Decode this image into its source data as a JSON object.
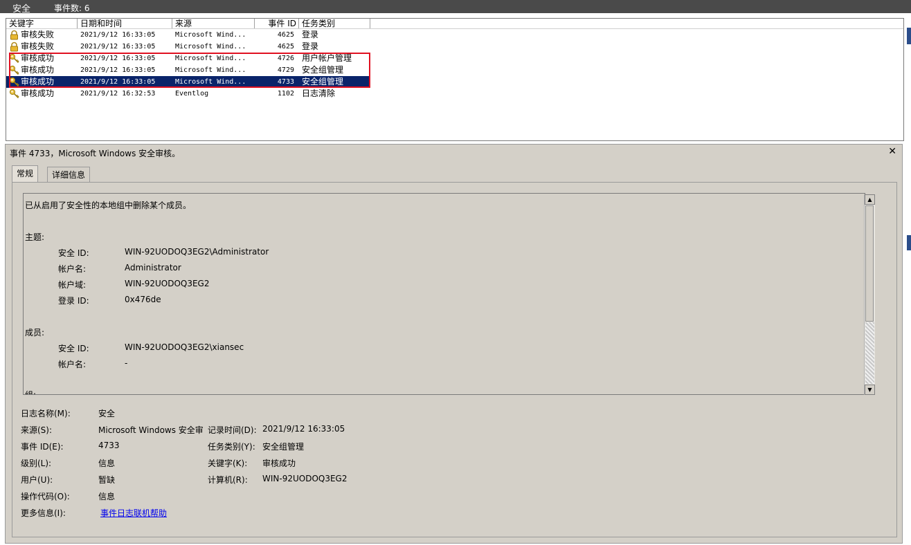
{
  "titlebar": {
    "log_name": "安全",
    "event_count": "事件数: 6"
  },
  "columns": [
    "关键字",
    "日期和时间",
    "来源",
    "事件 ID",
    "任务类别"
  ],
  "rows": [
    {
      "keyword": "审核失败",
      "datetime": "2021/9/12 16:33:05",
      "source": "Microsoft Wind...",
      "event_id": "4625",
      "category": "登录",
      "icon": "lock-icon",
      "selected": false
    },
    {
      "keyword": "审核失败",
      "datetime": "2021/9/12 16:33:05",
      "source": "Microsoft Wind...",
      "event_id": "4625",
      "category": "登录",
      "icon": "lock-icon",
      "selected": false
    },
    {
      "keyword": "审核成功",
      "datetime": "2021/9/12 16:33:05",
      "source": "Microsoft Wind...",
      "event_id": "4726",
      "category": "用户帐户管理",
      "icon": "key-icon",
      "selected": false
    },
    {
      "keyword": "审核成功",
      "datetime": "2021/9/12 16:33:05",
      "source": "Microsoft Wind...",
      "event_id": "4729",
      "category": "安全组管理",
      "icon": "key-icon",
      "selected": false
    },
    {
      "keyword": "审核成功",
      "datetime": "2021/9/12 16:33:05",
      "source": "Microsoft Wind...",
      "event_id": "4733",
      "category": "安全组管理",
      "icon": "key-icon",
      "selected": true
    },
    {
      "keyword": "审核成功",
      "datetime": "2021/9/12 16:32:53",
      "source": "Eventlog",
      "event_id": "1102",
      "category": "日志清除",
      "icon": "key-icon",
      "selected": false
    }
  ],
  "detail": {
    "title": "事件 4733，Microsoft Windows 安全审核。",
    "tabs": [
      "常规",
      "详细信息"
    ],
    "message": {
      "summary": "已从启用了安全性的本地组中删除某个成员。",
      "subject_heading": "主题:",
      "subject": [
        {
          "label": "安全 ID:",
          "value": "WIN-92UODOQ3EG2\\Administrator"
        },
        {
          "label": "帐户名:",
          "value": "Administrator"
        },
        {
          "label": "帐户域:",
          "value": "WIN-92UODOQ3EG2"
        },
        {
          "label": "登录 ID:",
          "value": "0x476de"
        }
      ],
      "member_heading": "成员:",
      "member": [
        {
          "label": "安全 ID:",
          "value": "WIN-92UODOQ3EG2\\xiansec"
        },
        {
          "label": "帐户名:",
          "value": "-"
        }
      ],
      "group_heading_partial": "组:"
    },
    "props": {
      "log_name_label": "日志名称(M):",
      "log_name": "安全",
      "source_label": "来源(S):",
      "source": "Microsoft Windows 安全审",
      "logged_label": "记录时间(D):",
      "logged": "2021/9/12 16:33:05",
      "event_id_label": "事件 ID(E):",
      "event_id": "4733",
      "task_label": "任务类别(Y):",
      "task": "安全组管理",
      "level_label": "级别(L):",
      "level": "信息",
      "keywords_label": "关键字(K):",
      "keywords": "审核成功",
      "user_label": "用户(U):",
      "user": "暂缺",
      "computer_label": "计算机(R):",
      "computer": "WIN-92UODOQ3EG2",
      "opcode_label": "操作代码(O):",
      "opcode": "信息",
      "more_info_label": "更多信息(I):",
      "more_info_link": "事件日志联机帮助"
    }
  },
  "colors": {
    "selection": "#0a246a",
    "highlight_box": "#e01020",
    "panel": "#d4d0c8"
  }
}
